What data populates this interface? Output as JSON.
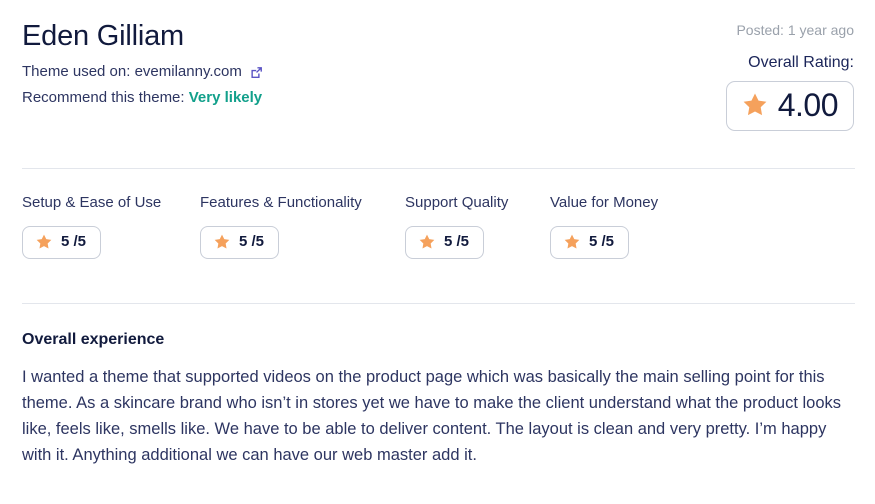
{
  "review": {
    "reviewer_name": "Eden Gilliam",
    "theme_used_label": "Theme used on: ",
    "theme_site": "evemilanny.com",
    "external_link_icon": "external-link-icon",
    "recommend_label": "Recommend this theme: ",
    "recommend_value": "Very likely",
    "posted": "Posted: 1 year ago",
    "overall_rating_label": "Overall Rating:",
    "overall_rating_value": "4.00",
    "star_icon": "star-icon"
  },
  "categories": [
    {
      "label": "Setup & Ease of Use",
      "score": "5 /5",
      "star_icon": "star-icon"
    },
    {
      "label": "Features & Functionality",
      "score": "5 /5",
      "star_icon": "star-icon"
    },
    {
      "label": "Support Quality",
      "score": "5 /5",
      "star_icon": "star-icon"
    },
    {
      "label": "Value for Money",
      "score": "5 /5",
      "star_icon": "star-icon"
    }
  ],
  "experience": {
    "title": "Overall experience",
    "body": "I wanted a theme that supported videos on the product page which was basically the main selling point for this theme. As a skincare brand who isn’t in stores yet we have to make the client understand what the product looks like, feels like, smells like. We have to be able to deliver content. The layout is clean and very pretty. I’m happy with it. Anything additional we can have our web master add it."
  },
  "colors": {
    "star": "#f5a15c",
    "recommend": "#12a08b",
    "text_dark": "#111a3d",
    "text_body": "#2d3561",
    "muted": "#9aa1ab",
    "border": "#c9ced8",
    "divider": "#e3e6ec",
    "link_icon": "#5b54c4"
  }
}
